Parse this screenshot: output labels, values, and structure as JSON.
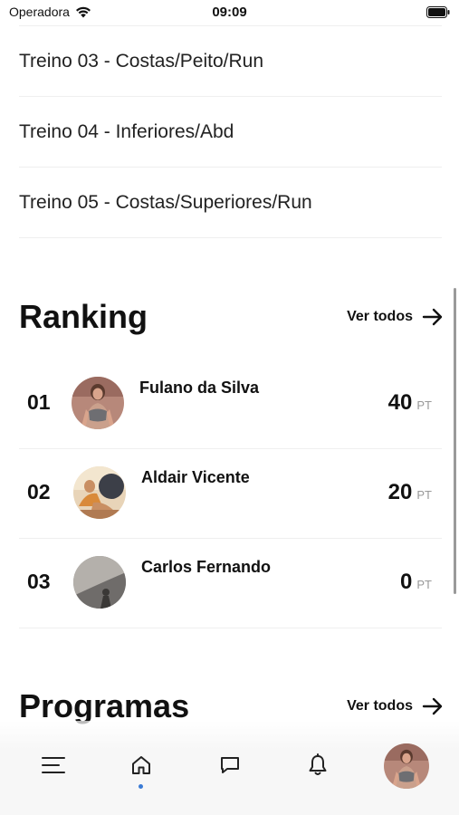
{
  "status_bar": {
    "carrier": "Operadora",
    "time": "09:09"
  },
  "workouts": [
    {
      "label": "Treino 03 - Costas/Peito/Run"
    },
    {
      "label": "Treino 04 - Inferiores/Abd"
    },
    {
      "label": "Treino 05 - Costas/Superiores/Run"
    }
  ],
  "ranking": {
    "title": "Ranking",
    "see_all": "Ver todos",
    "entries": [
      {
        "position": "01",
        "name": "Fulano da Silva",
        "points": "40",
        "unit": "PT"
      },
      {
        "position": "02",
        "name": "Aldair Vicente",
        "points": "20",
        "unit": "PT"
      },
      {
        "position": "03",
        "name": "Carlos Fernando",
        "points": "0",
        "unit": "PT"
      }
    ]
  },
  "programs": {
    "title": "Programas",
    "see_all": "Ver todos"
  },
  "bottom_nav": {
    "items": [
      "menu-icon",
      "home-icon",
      "chat-icon",
      "bell-icon",
      "profile-avatar"
    ],
    "active": "home-icon",
    "active_color": "#3a7bd5"
  }
}
